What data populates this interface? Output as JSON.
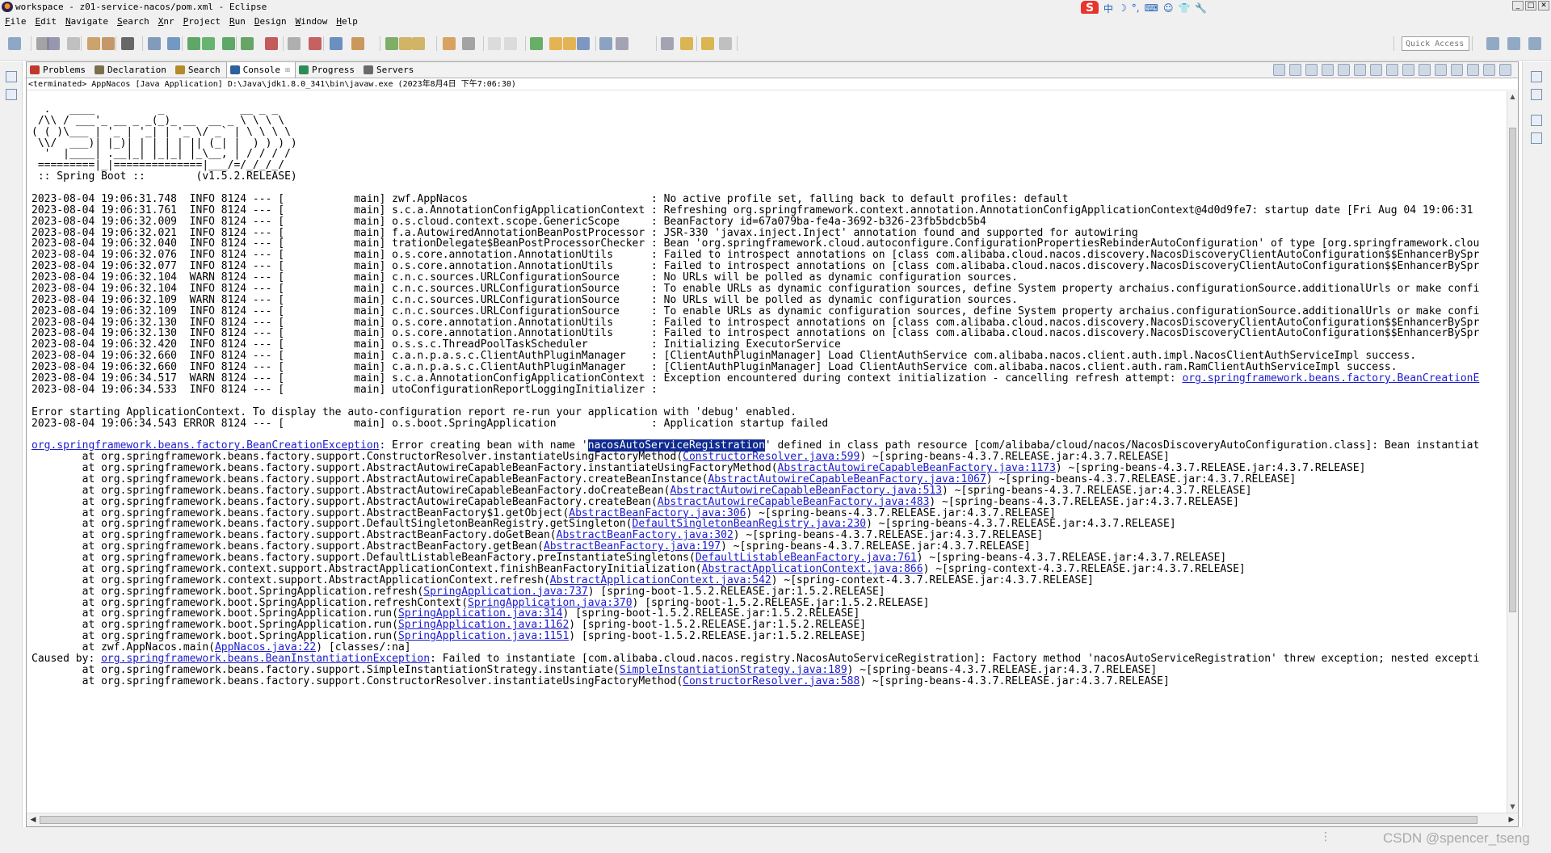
{
  "window": {
    "title": "workspace - z01-service-nacos/pom.xml - Eclipse",
    "app_icon": "eclipse-icon",
    "controls": [
      "minimize",
      "maximize",
      "close"
    ]
  },
  "ime_bar": {
    "items": [
      "S",
      "中",
      "☽",
      "°,",
      "⌨",
      "☺",
      "👕",
      "🔧"
    ]
  },
  "menubar": {
    "items": [
      "File",
      "Edit",
      "Navigate",
      "Search",
      "Xnr",
      "Project",
      "Run",
      "Design",
      "Window",
      "Help"
    ]
  },
  "toolbar": {
    "quick_access_placeholder": "Quick Access"
  },
  "views": {
    "tabs": [
      {
        "label": "Problems",
        "icon": "problems-icon",
        "color": "#c0392b",
        "active": false
      },
      {
        "label": "Declaration",
        "icon": "declaration-icon",
        "color": "#7a6f4f",
        "active": false
      },
      {
        "label": "Search",
        "icon": "search-icon",
        "color": "#b58a2a",
        "active": false
      },
      {
        "label": "Console",
        "icon": "console-icon",
        "color": "#2d5f9a",
        "active": true,
        "close": "☒"
      },
      {
        "label": "Progress",
        "icon": "progress-icon",
        "color": "#2e8b57",
        "active": false
      },
      {
        "label": "Servers",
        "icon": "servers-icon",
        "color": "#6a6a6a",
        "active": false
      }
    ]
  },
  "console": {
    "header": "<terminated> AppNacos [Java Application] D:\\Java\\jdk1.8.0_341\\bin\\javaw.exe (2023年8月4日 下午7:06:30)",
    "lines": [
      [
        {
          "t": ""
        }
      ],
      [
        {
          "t": "  .   ____          _            __ _ _"
        }
      ],
      [
        {
          "t": " /\\\\ / ___'_ __ _ _(_)_ __  __ _ \\ \\ \\ \\"
        }
      ],
      [
        {
          "t": "( ( )\\___ | '_ | '_| | '_ \\/ _` | \\ \\ \\ \\"
        }
      ],
      [
        {
          "t": " \\\\/  ___)| |_)| | | | | || (_| |  ) ) ) )"
        }
      ],
      [
        {
          "t": "  '  |____| .__|_| |_|_| |_\\__, | / / / /"
        }
      ],
      [
        {
          "t": " =========|_|==============|___/=/_/_/_/"
        }
      ],
      [
        {
          "t": " :: Spring Boot ::        (v1.5.2.RELEASE)"
        }
      ],
      [
        {
          "t": ""
        }
      ],
      [
        {
          "t": "2023-08-04 19:06:31.748  INFO 8124 --- [           main] zwf.AppNacos                             : No active profile set, falling back to default profiles: default"
        }
      ],
      [
        {
          "t": "2023-08-04 19:06:31.761  INFO 8124 --- [           main] s.c.a.AnnotationConfigApplicationContext : Refreshing org.springframework.context.annotation.AnnotationConfigApplicationContext@4d0d9fe7: startup date [Fri Aug 04 19:06:31"
        }
      ],
      [
        {
          "t": "2023-08-04 19:06:32.009  INFO 8124 --- [           main] o.s.cloud.context.scope.GenericScope     : BeanFactory id=67a079ba-fe4a-3692-b326-23fb5bdcb5b4"
        }
      ],
      [
        {
          "t": "2023-08-04 19:06:32.021  INFO 8124 --- [           main] f.a.AutowiredAnnotationBeanPostProcessor : JSR-330 'javax.inject.Inject' annotation found and supported for autowiring"
        }
      ],
      [
        {
          "t": "2023-08-04 19:06:32.040  INFO 8124 --- [           main] trationDelegate$BeanPostProcessorChecker : Bean 'org.springframework.cloud.autoconfigure.ConfigurationPropertiesRebinderAutoConfiguration' of type [org.springframework.clou"
        }
      ],
      [
        {
          "t": "2023-08-04 19:06:32.076  INFO 8124 --- [           main] o.s.core.annotation.AnnotationUtils      : Failed to introspect annotations on [class com.alibaba.cloud.nacos.discovery.NacosDiscoveryClientAutoConfiguration$$EnhancerBySpr"
        }
      ],
      [
        {
          "t": "2023-08-04 19:06:32.077  INFO 8124 --- [           main] o.s.core.annotation.AnnotationUtils      : Failed to introspect annotations on [class com.alibaba.cloud.nacos.discovery.NacosDiscoveryClientAutoConfiguration$$EnhancerBySpr"
        }
      ],
      [
        {
          "t": "2023-08-04 19:06:32.104  WARN 8124 --- [           main] c.n.c.sources.URLConfigurationSource     : No URLs will be polled as dynamic configuration sources."
        }
      ],
      [
        {
          "t": "2023-08-04 19:06:32.104  INFO 8124 --- [           main] c.n.c.sources.URLConfigurationSource     : To enable URLs as dynamic configuration sources, define System property archaius.configurationSource.additionalUrls or make confi"
        }
      ],
      [
        {
          "t": "2023-08-04 19:06:32.109  WARN 8124 --- [           main] c.n.c.sources.URLConfigurationSource     : No URLs will be polled as dynamic configuration sources."
        }
      ],
      [
        {
          "t": "2023-08-04 19:06:32.109  INFO 8124 --- [           main] c.n.c.sources.URLConfigurationSource     : To enable URLs as dynamic configuration sources, define System property archaius.configurationSource.additionalUrls or make confi"
        }
      ],
      [
        {
          "t": "2023-08-04 19:06:32.130  INFO 8124 --- [           main] o.s.core.annotation.AnnotationUtils      : Failed to introspect annotations on [class com.alibaba.cloud.nacos.discovery.NacosDiscoveryClientAutoConfiguration$$EnhancerBySpr"
        }
      ],
      [
        {
          "t": "2023-08-04 19:06:32.130  INFO 8124 --- [           main] o.s.core.annotation.AnnotationUtils      : Failed to introspect annotations on [class com.alibaba.cloud.nacos.discovery.NacosDiscoveryClientAutoConfiguration$$EnhancerBySpr"
        }
      ],
      [
        {
          "t": "2023-08-04 19:06:32.420  INFO 8124 --- [           main] o.s.s.c.ThreadPoolTaskScheduler          : Initializing ExecutorService"
        }
      ],
      [
        {
          "t": "2023-08-04 19:06:32.660  INFO 8124 --- [           main] c.a.n.p.a.s.c.ClientAuthPluginManager    : [ClientAuthPluginManager] Load ClientAuthService com.alibaba.nacos.client.auth.impl.NacosClientAuthServiceImpl success."
        }
      ],
      [
        {
          "t": "2023-08-04 19:06:32.660  INFO 8124 --- [           main] c.a.n.p.a.s.c.ClientAuthPluginManager    : [ClientAuthPluginManager] Load ClientAuthService com.alibaba.nacos.client.auth.ram.RamClientAuthServiceImpl success."
        }
      ],
      [
        {
          "t": "2023-08-04 19:06:34.517  WARN 8124 --- [           main] s.c.a.AnnotationConfigApplicationContext : Exception encountered during context initialization - cancelling refresh attempt: "
        },
        {
          "t": "org.springframework.beans.factory.BeanCreationE",
          "link": true
        }
      ],
      [
        {
          "t": "2023-08-04 19:06:34.533  INFO 8124 --- [           main] utoConfigurationReportLoggingInitializer : "
        }
      ],
      [
        {
          "t": ""
        }
      ],
      [
        {
          "t": "Error starting ApplicationContext. To display the auto-configuration report re-run your application with 'debug' enabled."
        }
      ],
      [
        {
          "t": "2023-08-04 19:06:34.543 ERROR 8124 --- [           main] o.s.boot.SpringApplication               : Application startup failed"
        }
      ],
      [
        {
          "t": ""
        }
      ],
      [
        {
          "t": "org.springframework.beans.factory.BeanCreationException",
          "link": true
        },
        {
          "t": ": Error creating bean with name '"
        },
        {
          "t": "nacosAutoServiceRegistration",
          "hl": true
        },
        {
          "t": "' defined in class path resource [com/alibaba/cloud/nacos/NacosDiscoveryAutoConfiguration.class]: Bean instantiat"
        }
      ],
      [
        {
          "t": "\tat org.springframework.beans.factory.support.ConstructorResolver.instantiateUsingFactoryMethod("
        },
        {
          "t": "ConstructorResolver.java:599",
          "link": true
        },
        {
          "t": ") ~[spring-beans-4.3.7.RELEASE.jar:4.3.7.RELEASE]"
        }
      ],
      [
        {
          "t": "\tat org.springframework.beans.factory.support.AbstractAutowireCapableBeanFactory.instantiateUsingFactoryMethod("
        },
        {
          "t": "AbstractAutowireCapableBeanFactory.java:1173",
          "link": true
        },
        {
          "t": ") ~[spring-beans-4.3.7.RELEASE.jar:4.3.7.RELEASE]"
        }
      ],
      [
        {
          "t": "\tat org.springframework.beans.factory.support.AbstractAutowireCapableBeanFactory.createBeanInstance("
        },
        {
          "t": "AbstractAutowireCapableBeanFactory.java:1067",
          "link": true
        },
        {
          "t": ") ~[spring-beans-4.3.7.RELEASE.jar:4.3.7.RELEASE]"
        }
      ],
      [
        {
          "t": "\tat org.springframework.beans.factory.support.AbstractAutowireCapableBeanFactory.doCreateBean("
        },
        {
          "t": "AbstractAutowireCapableBeanFactory.java:513",
          "link": true
        },
        {
          "t": ") ~[spring-beans-4.3.7.RELEASE.jar:4.3.7.RELEASE]"
        }
      ],
      [
        {
          "t": "\tat org.springframework.beans.factory.support.AbstractAutowireCapableBeanFactory.createBean("
        },
        {
          "t": "AbstractAutowireCapableBeanFactory.java:483",
          "link": true
        },
        {
          "t": ") ~[spring-beans-4.3.7.RELEASE.jar:4.3.7.RELEASE]"
        }
      ],
      [
        {
          "t": "\tat org.springframework.beans.factory.support.AbstractBeanFactory$1.getObject("
        },
        {
          "t": "AbstractBeanFactory.java:306",
          "link": true
        },
        {
          "t": ") ~[spring-beans-4.3.7.RELEASE.jar:4.3.7.RELEASE]"
        }
      ],
      [
        {
          "t": "\tat org.springframework.beans.factory.support.DefaultSingletonBeanRegistry.getSingleton("
        },
        {
          "t": "DefaultSingletonBeanRegistry.java:230",
          "link": true
        },
        {
          "t": ") ~[spring-beans-4.3.7.RELEASE.jar:4.3.7.RELEASE]"
        }
      ],
      [
        {
          "t": "\tat org.springframework.beans.factory.support.AbstractBeanFactory.doGetBean("
        },
        {
          "t": "AbstractBeanFactory.java:302",
          "link": true
        },
        {
          "t": ") ~[spring-beans-4.3.7.RELEASE.jar:4.3.7.RELEASE]"
        }
      ],
      [
        {
          "t": "\tat org.springframework.beans.factory.support.AbstractBeanFactory.getBean("
        },
        {
          "t": "AbstractBeanFactory.java:197",
          "link": true
        },
        {
          "t": ") ~[spring-beans-4.3.7.RELEASE.jar:4.3.7.RELEASE]"
        }
      ],
      [
        {
          "t": "\tat org.springframework.beans.factory.support.DefaultListableBeanFactory.preInstantiateSingletons("
        },
        {
          "t": "DefaultListableBeanFactory.java:761",
          "link": true
        },
        {
          "t": ") ~[spring-beans-4.3.7.RELEASE.jar:4.3.7.RELEASE]"
        }
      ],
      [
        {
          "t": "\tat org.springframework.context.support.AbstractApplicationContext.finishBeanFactoryInitialization("
        },
        {
          "t": "AbstractApplicationContext.java:866",
          "link": true
        },
        {
          "t": ") ~[spring-context-4.3.7.RELEASE.jar:4.3.7.RELEASE]"
        }
      ],
      [
        {
          "t": "\tat org.springframework.context.support.AbstractApplicationContext.refresh("
        },
        {
          "t": "AbstractApplicationContext.java:542",
          "link": true
        },
        {
          "t": ") ~[spring-context-4.3.7.RELEASE.jar:4.3.7.RELEASE]"
        }
      ],
      [
        {
          "t": "\tat org.springframework.boot.SpringApplication.refresh("
        },
        {
          "t": "SpringApplication.java:737",
          "link": true
        },
        {
          "t": ") [spring-boot-1.5.2.RELEASE.jar:1.5.2.RELEASE]"
        }
      ],
      [
        {
          "t": "\tat org.springframework.boot.SpringApplication.refreshContext("
        },
        {
          "t": "SpringApplication.java:370",
          "link": true
        },
        {
          "t": ") [spring-boot-1.5.2.RELEASE.jar:1.5.2.RELEASE]"
        }
      ],
      [
        {
          "t": "\tat org.springframework.boot.SpringApplication.run("
        },
        {
          "t": "SpringApplication.java:314",
          "link": true
        },
        {
          "t": ") [spring-boot-1.5.2.RELEASE.jar:1.5.2.RELEASE]"
        }
      ],
      [
        {
          "t": "\tat org.springframework.boot.SpringApplication.run("
        },
        {
          "t": "SpringApplication.java:1162",
          "link": true
        },
        {
          "t": ") [spring-boot-1.5.2.RELEASE.jar:1.5.2.RELEASE]"
        }
      ],
      [
        {
          "t": "\tat org.springframework.boot.SpringApplication.run("
        },
        {
          "t": "SpringApplication.java:1151",
          "link": true
        },
        {
          "t": ") [spring-boot-1.5.2.RELEASE.jar:1.5.2.RELEASE]"
        }
      ],
      [
        {
          "t": "\tat zwf.AppNacos.main("
        },
        {
          "t": "AppNacos.java:22",
          "link": true
        },
        {
          "t": ") [classes/:na]"
        }
      ],
      [
        {
          "t": "Caused by: "
        },
        {
          "t": "org.springframework.beans.BeanInstantiationException",
          "link": true
        },
        {
          "t": ": Failed to instantiate [com.alibaba.cloud.nacos.registry.NacosAutoServiceRegistration]: Factory method 'nacosAutoServiceRegistration' threw exception; nested excepti"
        }
      ],
      [
        {
          "t": "\tat org.springframework.beans.factory.support.SimpleInstantiationStrategy.instantiate("
        },
        {
          "t": "SimpleInstantiationStrategy.java:189",
          "link": true
        },
        {
          "t": ") ~[spring-beans-4.3.7.RELEASE.jar:4.3.7.RELEASE]"
        }
      ],
      [
        {
          "t": "\tat org.springframework.beans.factory.support.ConstructorResolver.instantiateUsingFactoryMethod("
        },
        {
          "t": "ConstructorResolver.java:588",
          "link": true
        },
        {
          "t": ") ~[spring-beans-4.3.7.RELEASE.jar:4.3.7.RELEASE]"
        }
      ]
    ]
  },
  "watermark": "CSDN @spencer_tseng"
}
